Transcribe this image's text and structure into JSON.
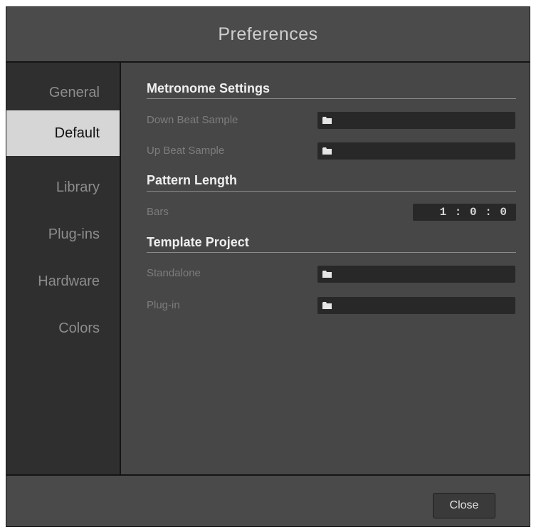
{
  "window": {
    "title": "Preferences"
  },
  "sidebar": {
    "items": [
      {
        "label": "General"
      },
      {
        "label": "Default",
        "active": true
      },
      {
        "label": "Library"
      },
      {
        "label": "Plug-ins"
      },
      {
        "label": "Hardware"
      },
      {
        "label": "Colors"
      }
    ]
  },
  "sections": {
    "metronome": {
      "title": "Metronome Settings",
      "down_beat_label": "Down Beat Sample",
      "down_beat_value": "",
      "up_beat_label": "Up Beat Sample",
      "up_beat_value": ""
    },
    "pattern": {
      "title": "Pattern Length",
      "bars_label": "Bars",
      "bars_value": "1 : 0 : 0"
    },
    "template": {
      "title": "Template Project",
      "standalone_label": "Standalone",
      "standalone_value": "",
      "plugin_label": "Plug-in",
      "plugin_value": ""
    }
  },
  "footer": {
    "close_label": "Close"
  },
  "icons": {
    "path_field_icon": "folder-icon"
  }
}
